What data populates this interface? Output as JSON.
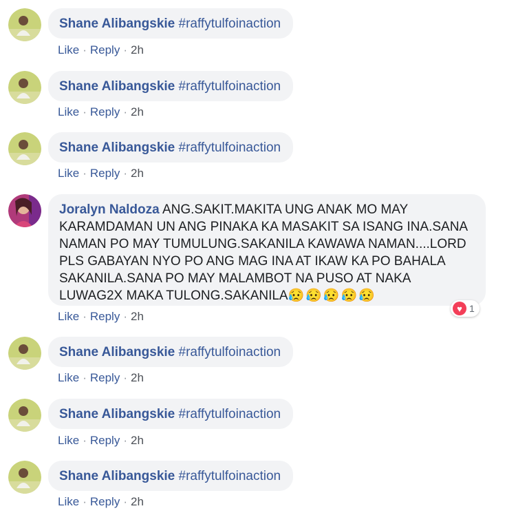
{
  "actions": {
    "like": "Like",
    "reply": "Reply",
    "separator": "·"
  },
  "comments": [
    {
      "author": "Shane Alibangskie",
      "text": "#raffytulfoinaction",
      "time": "2h"
    },
    {
      "author": "Shane Alibangskie",
      "text": "#raffytulfoinaction",
      "time": "2h"
    },
    {
      "author": "Shane Alibangskie",
      "text": "#raffytulfoinaction",
      "time": "2h"
    },
    {
      "author": "Joralyn Naldoza",
      "text": "ANG.SAKIT.MAKITA UNG ANAK MO MAY KARAMDAMAN UN ANG PINAKA KA MASAKIT SA ISANG INA.SANA NAMAN PO MAY TUMULUNG.SAKANILA KAWAWA NAMAN....LORD PLS GABAYAN NYO PO ANG MAG INA AT IKAW KA PO BAHALA SAKANILA.SANA PO MAY MALAMBOT NA PUSO AT NAKA LUWAG2X MAKA TULONG.SAKANILA",
      "emoji": "😥😥😥😥😥",
      "time": "2h",
      "reaction_count": "1"
    },
    {
      "author": "Shane Alibangskie",
      "text": "#raffytulfoinaction",
      "time": "2h"
    },
    {
      "author": "Shane Alibangskie",
      "text": "#raffytulfoinaction",
      "time": "2h"
    },
    {
      "author": "Shane Alibangskie",
      "text": "#raffytulfoinaction",
      "time": "2h"
    }
  ],
  "colors": {
    "link": "#385898",
    "bubble": "#f2f3f5",
    "love_reaction": "#f33e58"
  },
  "icons": {
    "reaction": "heart-love-icon"
  }
}
